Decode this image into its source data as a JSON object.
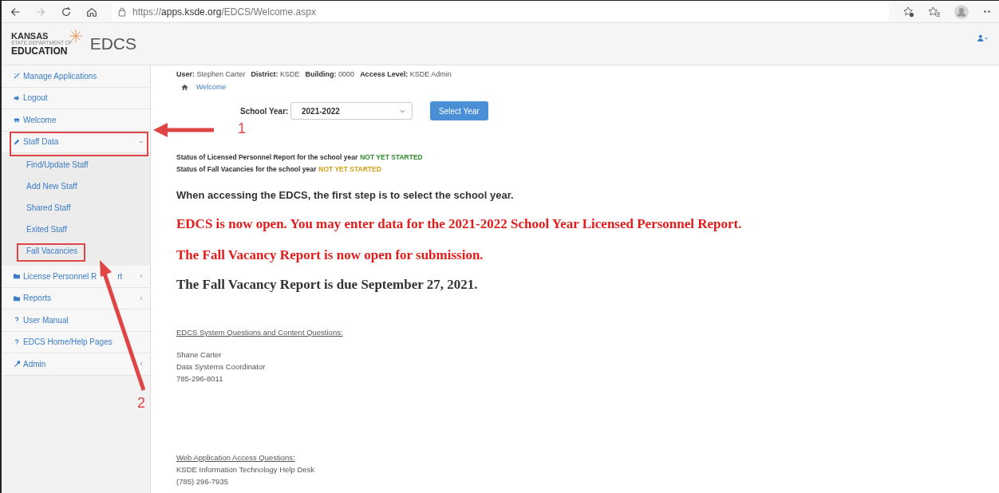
{
  "browser": {
    "url": "https://**apps.ksde.org**/EDCS/Welcome.aspx"
  },
  "header": {
    "logo_top": "KANSAS",
    "logo_middle": "STATE DEPARTMENT OF",
    "logo_bottom": "EDUCATION",
    "app_name": "EDCS"
  },
  "sidebar": {
    "items": [
      {
        "label": "Manage Applications",
        "kind": "link"
      },
      {
        "label": "Logout",
        "kind": "link"
      },
      {
        "label": "Welcome",
        "kind": "link"
      },
      {
        "label": "Staff Data",
        "kind": "group",
        "expanded": true,
        "children": [
          {
            "label": "Find/Update Staff"
          },
          {
            "label": "Add New Staff"
          },
          {
            "label": "Shared Staff"
          },
          {
            "label": "Exited Staff"
          },
          {
            "label": "Fall Vacancies"
          }
        ]
      },
      {
        "label": "License Personnel R",
        "label_tail": "rt",
        "kind": "group",
        "expanded": false
      },
      {
        "label": "Reports",
        "kind": "group",
        "expanded": false
      },
      {
        "label": "User Manual",
        "kind": "link"
      },
      {
        "label": "EDCS Home/Help Pages",
        "kind": "link"
      },
      {
        "label": "Admin",
        "kind": "group",
        "expanded": false
      }
    ]
  },
  "user_info": [
    {
      "label": "User:",
      "value": "Stephen Carter"
    },
    {
      "label": "District:",
      "value": "KSDE"
    },
    {
      "label": "Building:",
      "value": "0000"
    },
    {
      "label": "Access Level:",
      "value": "KSDE Admin"
    }
  ],
  "breadcrumb": [
    "Welcome"
  ],
  "school_year": {
    "label": "School Year:",
    "value": "2021-2022",
    "button": "Select Year"
  },
  "statuses": [
    {
      "text": "Status of Licensed Personnel Report for the school year",
      "status": "NOT YET STARTED",
      "color": "#2e8b2e"
    },
    {
      "text": "Status of Fall Vacancies for the school year",
      "status": "NOT YET STARTED",
      "color": "#d4a017"
    }
  ],
  "messages": [
    {
      "kind": "intro",
      "text": "When accessing the EDCS, the first step is to select the school year."
    },
    {
      "kind": "alert",
      "text": "EDCS is now open. You may enter data for the 2021-2022 School Year Licensed Personnel Report."
    },
    {
      "kind": "alert",
      "text": "The Fall Vacancy Report is now open for submission."
    },
    {
      "kind": "notice",
      "text": "The Fall Vacancy Report is due September 27, 2021."
    }
  ],
  "contacts": [
    {
      "heading": "EDCS System Questions and Content Questions:",
      "lines": [
        "Shane Carter",
        "Data Systems Coordinator",
        "785-296-8011"
      ]
    },
    {
      "heading": "Web Application Access Questions:",
      "lines": [
        "KSDE Information Technology Help Desk",
        "(785) 296-7935"
      ]
    }
  ],
  "annotations": [
    {
      "label": "1"
    },
    {
      "label": "2"
    }
  ]
}
